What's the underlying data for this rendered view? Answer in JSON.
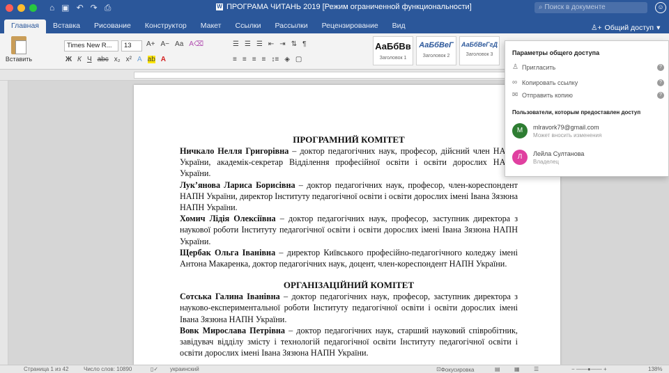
{
  "window": {
    "title": "ПРОГРАМА ЧИТАНЬ 2019 [Режим ограниченной функциональности]",
    "search_placeholder": "Поиск в документе",
    "account_icon": "smiley-icon"
  },
  "ribbon": {
    "tabs": [
      "Главная",
      "Вставка",
      "Рисование",
      "Конструктор",
      "Макет",
      "Ссылки",
      "Рассылки",
      "Рецензирование",
      "Вид"
    ],
    "active_tab": "Главная",
    "share_label": "Общий доступ",
    "paste_label": "Вставить",
    "font_name": "Times New R...",
    "font_size": "13",
    "styles": [
      {
        "sample": "АаБбВв",
        "name": "Заголовок 1"
      },
      {
        "sample": "АаБбВеГ",
        "name": "Заголовок 2"
      },
      {
        "sample": "АаБбВеГгД",
        "name": "Заголовок 3"
      }
    ]
  },
  "share_panel": {
    "header": "Параметры общего доступа",
    "actions": [
      {
        "label": "Пригласить",
        "icon": "person-icon"
      },
      {
        "label": "Копировать ссылку",
        "icon": "link-icon"
      },
      {
        "label": "Отправить копию",
        "icon": "mail-icon"
      }
    ],
    "users_header": "Пользователи, которым предоставлен доступ",
    "users": [
      {
        "initial": "M",
        "name": "mlravork79@gmail.com",
        "status": "Может вносить изменения",
        "color": "#2e7d32"
      },
      {
        "initial": "Л",
        "name": "Лейла Султанова",
        "status": "Владелец",
        "color": "#e040a0"
      }
    ]
  },
  "document": {
    "heading1": "ПРОГРАМНИЙ КОМІТЕТ",
    "committee1": [
      {
        "name": "Ничкало Нелля Григорівна",
        "desc": " – доктор педагогічних наук, професор, дійсний член НАПН України, академік-секретар Відділення професійної освіти і освіти дорослих НАПН України."
      },
      {
        "name": "Лук’янова Лариса Борисівна",
        "desc": " – доктор педагогічних наук, професор, член-кореспондент НАПН України, директор Інституту педагогічної освіти і освіти дорослих імені Івана Зязюна НАПН України."
      },
      {
        "name": "Хомич Лідія Олексіївна",
        "desc": " – доктор педагогічних наук, професор, заступник директора з наукової роботи Інституту педагогічної освіти і освіти дорослих імені Івана Зязюна НАПН України."
      },
      {
        "name": "Щербак Ольга Іванівна",
        "desc": " – директор Київського професійно-педагогічного коледжу імені Антона Макаренка, доктор педагогічних наук, доцент, член-кореспондент НАПН України."
      }
    ],
    "heading2": "ОРГАНІЗАЦІЙНИЙ КОМІТЕТ",
    "committee2": [
      {
        "name": "Сотська Галина Іванівна",
        "desc": " – доктор педагогічних наук, професор, заступник директора з науково-експериментальної роботи Інституту педагогічної освіти і освіти дорослих імені Івана Зязюна НАПН України."
      },
      {
        "name": "Вовк Мирослава Петрівна",
        "desc": " – доктор педагогічних наук, старший науковий співробітник, завідувач відділу змісту і технологій педагогічної освіти Інституту педагогічної освіти і освіти дорослих імені Івана Зязюна НАПН України."
      }
    ]
  },
  "status": {
    "page": "Страница 1 из 42",
    "words": "Число слов: 10890",
    "language": "украинский",
    "focus": "Фокусировка",
    "zoom": "138%"
  }
}
